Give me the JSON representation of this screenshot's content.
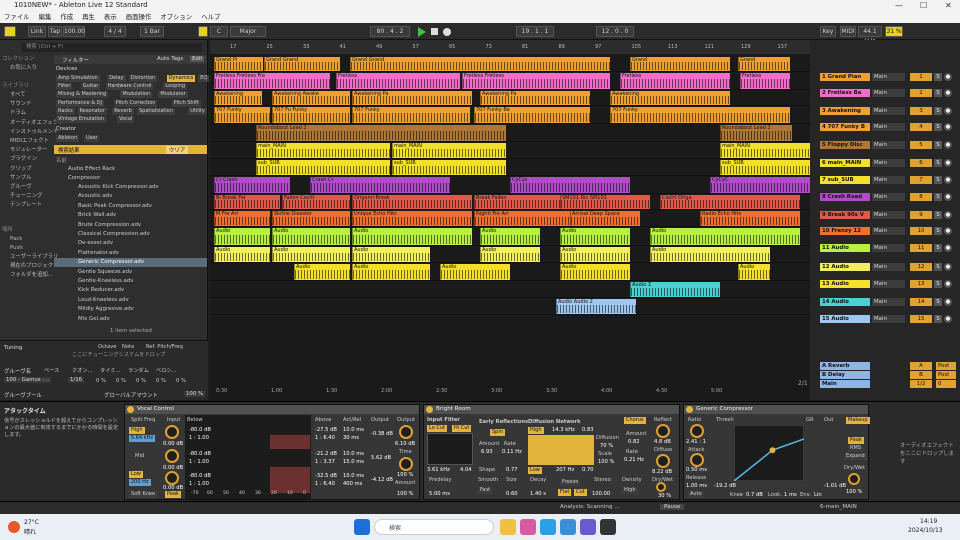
{
  "window": {
    "title": "1010NEW* - Ableton Live 12 Standard",
    "minimize": "—",
    "maximize": "☐",
    "close": "✕"
  },
  "menu": [
    "ファイル",
    "編集",
    "作成",
    "再生",
    "表示",
    "画面操作",
    "オプション",
    "ヘルプ"
  ],
  "transport": {
    "link": "Link",
    "tap": "Tap",
    "tempo": "100.00",
    "sig": "4 / 4",
    "quant": "1 Bar",
    "key": "C",
    "scale": "Major",
    "pos": "80 . 4 . 2",
    "loop_start": "19 . 1 . 1",
    "loop_len": "12 . 0 . 0",
    "key_btn": "Key",
    "midi_btn": "MIDI",
    "sample_rate": "44.1 kHz",
    "cpu": "31 %"
  },
  "browser": {
    "search_placeholder": "検索 (Ctrl + F)",
    "collections_title": "コレクション",
    "favorites": "お気に入り",
    "library_title": "ライブラリ",
    "library": [
      "すべて",
      "サウンド",
      "ドラム",
      "オーディオエフェクト",
      "インストゥルメント",
      "MIDIエフェクト",
      "モジュレーター",
      "プラグイン",
      "クリップ",
      "サンプル",
      "グルーヴ",
      "チューニング",
      "テンプレート"
    ],
    "places_title": "場所",
    "places": [
      "Pack",
      "Push",
      "ユーザーライブラリ",
      "現在のプロジェクト",
      "フォルダを追加..."
    ],
    "filter_label": "フィルター",
    "auto_tags": "Auto Tags",
    "edit": "Edit",
    "devices_label": "Devices",
    "tags": [
      [
        "Amp Simulation",
        "Delay",
        "Distortion",
        "Dynamics",
        "EQ"
      ],
      [
        "Filter",
        "Guitar",
        "Hardware Control",
        "Looping"
      ],
      [
        "Mixing & Mastering",
        "Modulation",
        "Modulator"
      ],
      [
        "Performance & DJ",
        "Pitch Correction",
        "Pitch Shift"
      ],
      [
        "Racks",
        "Resonator",
        "Reverb",
        "Spatialization",
        "Utility"
      ],
      [
        "Vintage Emulation",
        "Vocal"
      ]
    ],
    "creator_label": "Creator",
    "creators": [
      "Ableton",
      "User"
    ],
    "results_label": "検索結果",
    "clear": "クリア",
    "name_header": "名前",
    "folders": [
      "Audio Effect Rack",
      "Compressor"
    ],
    "items": [
      "Acoustic Kick Compressor.adv",
      "Acoustic.adv",
      "Basic Peak Compressor.adv",
      "Brick Wall.adv",
      "Brute Compression.adv",
      "Classical Compression.adv",
      "De-esser.adv",
      "Flattenator.adv",
      "Generic Compressor.adv",
      "Gentle Squeeze.adv",
      "Gentle-Kneeless.adv",
      "Kick Reducer.adv",
      "Loud-Kneeless.adv",
      "Mildly Aggresive.adv",
      "Mix Gel.adv"
    ],
    "selected_index": 8,
    "count": "1 item selected"
  },
  "tuning": {
    "title": "Tuning",
    "cols": [
      "Octave",
      "Note",
      "Ref. Pitch/Freq"
    ],
    "hint": "ここにチューニングシステムをドロップ",
    "groove_label": "グルーヴ名",
    "groove_cols": [
      "ベース",
      "クオン...",
      "タイミ...",
      "ランダム",
      "ベロシ..."
    ],
    "groove_name": "100 - Gamus -...",
    "groove_base": "1/16",
    "groove_vals": [
      "0 %",
      "0 %",
      "0 %",
      "0 %",
      "0 %"
    ],
    "global_label": "グルーヴプール",
    "global_amount": "グローバルアマウント",
    "global_val": "100 %"
  },
  "ruler": [
    "17",
    "25",
    "33",
    "41",
    "49",
    "57",
    "65",
    "73",
    "81",
    "89",
    "97",
    "105",
    "113",
    "121",
    "129",
    "137",
    "145"
  ],
  "time_marks": [
    "0:30",
    "1:00",
    "1:30",
    "2:00",
    "2:30",
    "3:00",
    "3:30",
    "4:00",
    "4:30",
    "5:00"
  ],
  "arr_zoom": "2/1",
  "lanes": [
    {
      "color": "#f0a030",
      "clips": [
        [
          "Grand Pi",
          4,
          53
        ],
        [
          "Grand Grand",
          54,
          130
        ],
        [
          "Grand Grand",
          140,
          400
        ],
        [
          "Grand",
          420,
          520
        ],
        [
          "Grand",
          528,
          580
        ]
      ]
    },
    {
      "color": "#f06ec8",
      "clips": [
        [
          "Fretless Fretless Fre",
          4,
          120
        ],
        [
          "Fretless",
          126,
          250
        ],
        [
          "Fretless Fretless",
          252,
          400
        ],
        [
          "Fretless",
          410,
          520
        ],
        [
          "Fretless",
          530,
          580
        ]
      ]
    },
    {
      "color": "#f0a030",
      "clips": [
        [
          "Awakening",
          4,
          52
        ],
        [
          "Awakening Awake",
          62,
          140
        ],
        [
          "Awakening Pa",
          142,
          262
        ],
        [
          "Awakening Pa",
          270,
          380
        ],
        [
          "Awakening",
          400,
          520
        ]
      ]
    },
    {
      "color": "#f0a030",
      "clips": [
        [
          "707 Funky",
          4,
          60
        ],
        [
          "707 Fu Funky",
          62,
          140
        ],
        [
          "707 Funky",
          142,
          260
        ],
        [
          "707 Funky Be",
          264,
          380
        ],
        [
          "707 Funky",
          400,
          580
        ]
      ]
    },
    {
      "color": "#b07836",
      "clips": [
        [
          "Roundabout Lead 2",
          46,
          296
        ],
        [
          "Roundabout Lead 2",
          510,
          582
        ]
      ]
    },
    {
      "color": "#f2e02a",
      "clips": [
        [
          "main_MAIN",
          46,
          180
        ],
        [
          "main_MAIN",
          182,
          296
        ],
        [
          "main_MAIN",
          510,
          600
        ]
      ]
    },
    {
      "color": "#f2e02a",
      "clips": [
        [
          "sub_SUB",
          46,
          180
        ],
        [
          "sub_SUB",
          182,
          296
        ],
        [
          "sub_SUB",
          510,
          600
        ]
      ]
    },
    {
      "color": "#b04cc8",
      "clips": [
        [
          "Cr Crash",
          4,
          80
        ],
        [
          "Crash Cr",
          100,
          240
        ],
        [
          "CyCyc",
          300,
          420
        ],
        [
          "CyCyC",
          500,
          600
        ]
      ]
    },
    {
      "color": "#e05a4a",
      "clips": [
        [
          "Bi Break Fal",
          4,
          70
        ],
        [
          "Fallen Cocht",
          72,
          140
        ],
        [
          "Origami Break",
          142,
          262
        ],
        [
          "Break Fallen",
          264,
          370
        ],
        [
          "SM101 Ric SM101",
          350,
          440
        ],
        [
          "Cocht Origa",
          450,
          590
        ]
      ]
    },
    {
      "color": "#f07030",
      "clips": [
        [
          "M Fre Arr",
          4,
          60
        ],
        [
          "Skittle Disaster",
          62,
          140
        ],
        [
          "Unique Echo Hits",
          142,
          262
        ],
        [
          "Nightl Fre Arr",
          264,
          380
        ],
        [
          "Arrival Deep Space",
          360,
          430
        ],
        [
          "Radio Echo Hits",
          490,
          590
        ]
      ]
    },
    {
      "color": "#b8f042",
      "clips": [
        [
          "Audio",
          4,
          60
        ],
        [
          "Audio",
          62,
          140
        ],
        [
          "Audio",
          142,
          262
        ],
        [
          "Audio",
          270,
          330
        ],
        [
          "Audio",
          350,
          420
        ],
        [
          "Audio",
          440,
          590
        ]
      ]
    },
    {
      "color": "#f2f05a",
      "clips": [
        [
          "Audio",
          4,
          60
        ],
        [
          "Audio",
          62,
          140
        ],
        [
          "Audio",
          142,
          220
        ],
        [
          "Audio",
          270,
          330
        ],
        [
          "Audio",
          350,
          420
        ],
        [
          "Audio",
          440,
          560
        ]
      ]
    },
    {
      "color": "#f2e02a",
      "clips": [
        [
          "Audio",
          84,
          140
        ],
        [
          "Audio",
          142,
          220
        ],
        [
          "Audio",
          230,
          300
        ],
        [
          "Audio",
          350,
          420
        ],
        [
          "Audio",
          528,
          560
        ]
      ]
    },
    {
      "color": "#4ad0d0",
      "clips": [
        [
          "Audio 3",
          420,
          510
        ]
      ]
    },
    {
      "color": "#9fc8f0",
      "clips": [
        [
          "Audio Audio 2",
          346,
          426
        ]
      ]
    }
  ],
  "tracks": [
    {
      "name": "1 Grand Pian",
      "color": "#f0a030",
      "io": "Main",
      "num": "1"
    },
    {
      "name": "2 Fretless Ba",
      "color": "#f06ec8",
      "io": "Main",
      "num": "2"
    },
    {
      "name": "3 Awakening",
      "color": "#f0a030",
      "io": "Main",
      "num": "3"
    },
    {
      "name": "4 707 Funky B",
      "color": "#f0a030",
      "io": "Main",
      "num": "4"
    },
    {
      "name": "5 Floppy Disc",
      "color": "#b07836",
      "io": "Main",
      "num": "5"
    },
    {
      "name": "6 main_MAIN",
      "color": "#f2e02a",
      "io": "Main",
      "num": "6"
    },
    {
      "name": "7 sub_SUB",
      "color": "#f2e02a",
      "io": "Main",
      "num": "7"
    },
    {
      "name": "8 Crash Road",
      "color": "#b04cc8",
      "io": "Main",
      "num": "8"
    },
    {
      "name": "9 Break 90s V",
      "color": "#e05a4a",
      "io": "Main",
      "num": "9"
    },
    {
      "name": "10 Frenzy 12",
      "color": "#f07030",
      "io": "Main",
      "num": "10"
    },
    {
      "name": "11 Audio",
      "color": "#b8f042",
      "io": "Main",
      "num": "11"
    },
    {
      "name": "12 Audio",
      "color": "#f2f05a",
      "io": "Main",
      "num": "12"
    },
    {
      "name": "13 Audio",
      "color": "#f2e02a",
      "io": "Main",
      "num": "13"
    },
    {
      "name": "14 Audio",
      "color": "#4ad0d0",
      "io": "Main",
      "num": "14"
    },
    {
      "name": "15 Audio",
      "color": "#9fc8f0",
      "io": "Main",
      "num": "15"
    }
  ],
  "returns": [
    {
      "name": "A Reverb",
      "color": "#8fb4e6",
      "num": "A",
      "post": "Post"
    },
    {
      "name": "B Delay",
      "color": "#8fb4e6",
      "num": "B",
      "post": "Post"
    },
    {
      "name": "Main",
      "color": "#8fb4e6",
      "num": "1/2",
      "post": "0"
    }
  ],
  "devices": {
    "attack_title": "アタックタイム",
    "attack_help": "信号がスレッショルドを超えてからコンプレッションの最大値に到達するまでにかかる時間を設定します。",
    "vocal_title": "Vocal Control",
    "vocal": {
      "split_freq": "Split Freq",
      "input": "Input",
      "high": "High",
      "high_freq": "5.64 kHz",
      "high_gain": "0.00 dB",
      "mid": "Mid",
      "mid_gain": "0.00 dB",
      "low": "Low",
      "low_freq": "200 Hz",
      "low_gain": "0.00 dB",
      "soft_knee": "Soft Knee",
      "peak": "Peak",
      "below": "Below",
      "above": "Above",
      "act_rel": "Act/Rel",
      "output": "Output",
      "b1": "-80.0 dB",
      "b1r": "1 : 1.00",
      "b2": "-80.0 dB",
      "b2r": "1 : 1.00",
      "b3": "-80.0 dB",
      "b3r": "1 : 1.00",
      "a1": "-27.5 dB",
      "a1r": "1 : 6.40",
      "a2": "-21.2 dB",
      "a2r": "1 : 3.37",
      "a3": "-32.5 dB",
      "a3r": "1 : 6.40",
      "r1": "10.0 ms",
      "r1b": "30 ms",
      "r2": "10.0 ms",
      "r2b": "15.0 ms",
      "r3": "10.0 ms",
      "r3b": "400 ms",
      "o1": "-0.38 dB",
      "o2": "5.62 dB",
      "o3": "-4.12 dB",
      "out_label": "Output",
      "time_label": "Time",
      "amount_label": "Amount",
      "out_val": "6.10 dB",
      "time_val": "100 %",
      "amount_val": "100 %",
      "axis": [
        "-70",
        "60",
        "50",
        "40",
        "30",
        "20",
        "10",
        "0"
      ]
    },
    "room_title": "Bright Room",
    "room": {
      "input_filter": "Input Filter",
      "lo_cut": "Lo Cut",
      "hi_cut": "Hi Cut",
      "er": "Early Reflections",
      "spin": "Spin",
      "amount": "Amount",
      "amount_val": "6.93",
      "rate": "Rate",
      "rate_val": "0.11 Hz",
      "shape": "Shape",
      "shape_val": "0.77",
      "freq1": "3.61 kHz",
      "freq2": "4.04",
      "diffusion": "Diffusion Network",
      "high": "High",
      "high_val": "14.3 kHz",
      "high_q": "0.83",
      "chorus": "Chorus",
      "diff_label": "Diffusion",
      "diff_val": "70 %",
      "scale": "Scale",
      "scale_val": "100 %",
      "ch_amount": "Amount",
      "ch_amount_val": "0.82",
      "ch_rate": "Rate",
      "ch_rate_val": "0.21 Hz",
      "low": "Low",
      "low_freq": "207 Hz",
      "low_val": "0.70",
      "predelay": "Predelay",
      "predelay_val": "5.00 ms",
      "smooth": "Smooth",
      "smooth_val": "Fast",
      "size": "Size",
      "size_val": "0.60",
      "decay": "Decay",
      "decay_val": "1.40 s",
      "freeze": "Freeze",
      "flat": "Flat",
      "cut": "Cut",
      "stereo": "Stereo",
      "stereo_val": "100.00",
      "density": "Density",
      "density_val": "High",
      "reflect": "Reflect",
      "reflect_val": "4.8 dB",
      "diffuse": "Diffuse",
      "diffuse_val": "8.22 dB",
      "drywet": "Dry/Wet",
      "drywet_val": "30 %"
    },
    "comp_title": "Generic Compressor",
    "comp": {
      "ratio": "Ratio",
      "ratio_val": "2.41 : 1",
      "attack": "Attack",
      "attack_val": "0.50 ms",
      "release": "Release",
      "release_val": "1.00 ms",
      "auto": "Auto",
      "thresh": "Thresh",
      "gr": "GR",
      "out": "Out",
      "thresh_val": "-19.2 dB",
      "out_val": "-1.01 dB",
      "knee": "Knee",
      "knee_val": "0.7 dB",
      "look": "Look.",
      "look_val": "1 ms",
      "env": "Env.",
      "env_val": "Lin",
      "makeup": "Makeup",
      "peak": "Peak",
      "rms": "RMS",
      "expand": "Expand",
      "drywet": "Dry/Wet",
      "drywet_val": "100 %",
      "curve": [
        [
          0,
          100
        ],
        [
          55,
          45
        ],
        [
          100,
          25
        ]
      ]
    },
    "drop_hint": "オーディオエフェクトをここにドロップします"
  },
  "status": {
    "text": "Analysis: Scanning ...",
    "pause": "Pause",
    "track": "6-main_MAIN"
  },
  "taskbar": {
    "temp": "27°C",
    "weather": "晴れ",
    "search": "検索",
    "time": "14:19",
    "date": "2024/10/13"
  }
}
